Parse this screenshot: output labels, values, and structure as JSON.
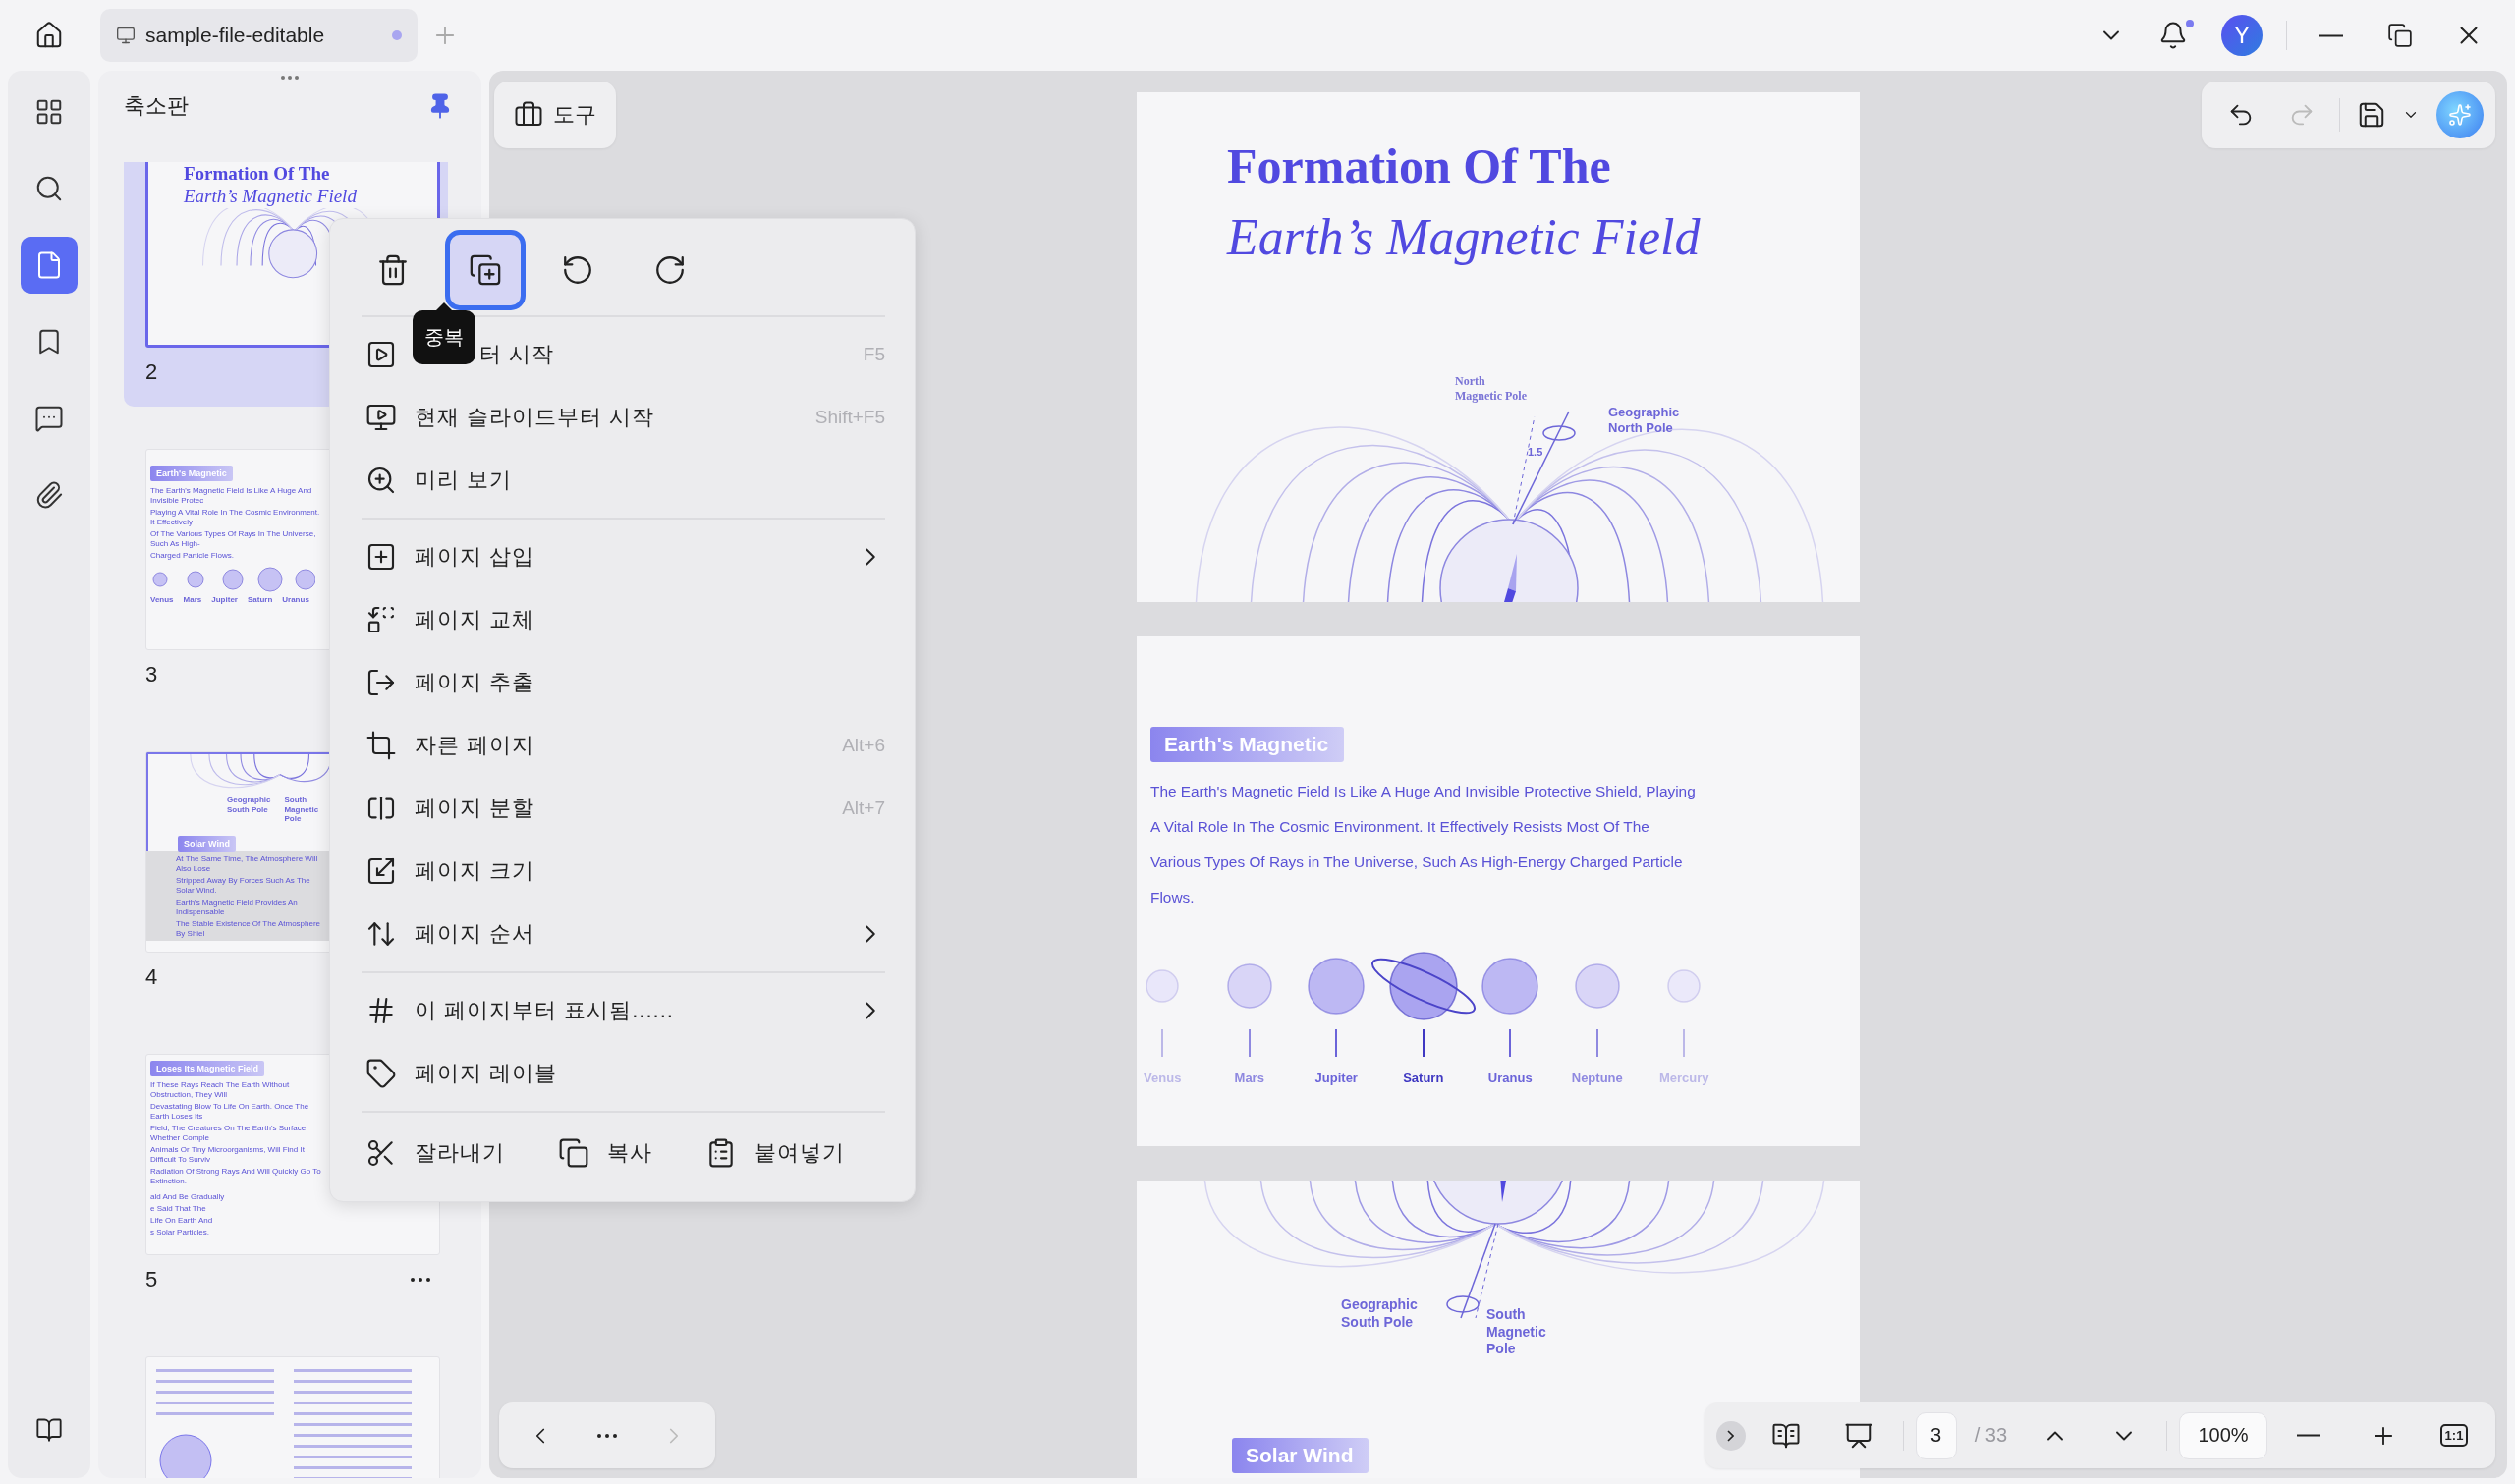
{
  "titlebar": {
    "tab": {
      "title": "sample-file-editable",
      "unsaved": true
    },
    "notification": {
      "unread": true
    },
    "avatar": "Y"
  },
  "sidebar": {
    "items": [
      {
        "selected": false
      },
      {
        "selected": false
      },
      {
        "selected": true
      },
      {
        "selected": false
      },
      {
        "selected": false
      },
      {
        "selected": false
      }
    ]
  },
  "thumbnails": {
    "title": "축소판",
    "pages": [
      {
        "kind": "title",
        "label": "2",
        "selected": true,
        "title": "Formation Of The",
        "subtitle": "Earth’s Magnetic Field"
      },
      {
        "kind": "planets",
        "label": "3",
        "selected": false,
        "heading": "Earth's Magnetic",
        "lines": [
          "The Earth's Magnetic Field Is Like A Huge And Invisible Protec",
          "Playing A Vital Role In The Cosmic Environment. It Effectively",
          "Of The Various Types Of Rays In The Universe, Such As High-",
          "Charged Particle Flows."
        ],
        "planets": [
          "Venus",
          "Mars",
          "Jupiter",
          "Saturn",
          "Uranus"
        ]
      },
      {
        "kind": "field",
        "label": "4",
        "selected": false,
        "labels": [
          "Geographic\nSouth Pole",
          "South\nMagnetic\nPole"
        ],
        "heading": "Solar Wind",
        "lines": [
          "At The Same Time, The Atmosphere Will Also Lose",
          "Stripped Away By Forces Such As The Solar Wind.",
          "Earth's Magnetic Field Provides An Indispensable",
          "The Stable Existence Of The Atmosphere By Shiel"
        ]
      },
      {
        "kind": "text",
        "label": "5",
        "selected": false,
        "more": true,
        "heading": "Loses Its Magnetic Field",
        "lines": [
          "If These Rays Reach The Earth Without Obstruction, They Will",
          "Devastating Blow To Life On Earth. Once The Earth Loses Its",
          "Field, The Creatures On The Earth's Surface, Whether Comple",
          "Animals Or Tiny Microorganisms, Will Find It Difficult To Surviv",
          "Radiation Of Strong Rays And Will Quickly Go To Extinction."
        ],
        "tail": [
          "ald And Be Gradually",
          "e Said That The",
          "Life On Earth And",
          "s Solar Particles."
        ]
      },
      {
        "kind": "columns",
        "selected": false
      }
    ]
  },
  "tools_button": "도구",
  "context_menu": {
    "actions": [
      {
        "selected": false
      },
      {
        "selected": true
      },
      {
        "selected": false
      },
      {
        "selected": false
      }
    ],
    "tooltip": "중복",
    "groups": [
      [
        {
          "label": "터 시작",
          "shortcut": "F5",
          "submenu": false
        },
        {
          "label": "현재 슬라이드부터 시작",
          "shortcut": "Shift+F5",
          "submenu": false
        },
        {
          "label": "미리 보기",
          "submenu": false
        }
      ],
      [
        {
          "label": "페이지 삽입",
          "submenu": true
        },
        {
          "label": "페이지 교체",
          "submenu": false
        },
        {
          "label": "페이지 추출",
          "submenu": false
        },
        {
          "label": "자른 페이지",
          "shortcut": "Alt+6",
          "submenu": false
        },
        {
          "label": "페이지 분할",
          "shortcut": "Alt+7",
          "submenu": false
        },
        {
          "label": "페이지 크기",
          "submenu": false
        },
        {
          "label": "페이지 순서",
          "submenu": true
        }
      ],
      [
        {
          "label": "이 페이지부터 표시됨......",
          "submenu": true
        },
        {
          "label": "페이지 레이블",
          "submenu": false
        }
      ]
    ],
    "clipboard": [
      "잘라내기",
      "복사",
      "붙여넣기"
    ]
  },
  "slides": [
    {
      "kind": "title",
      "title": "Formation Of The",
      "subtitle": "Earth’s Magnetic Field",
      "magnetic_pole": "North\nMagnetic Pole",
      "geographic_pole": "Geographic\nNorth Pole",
      "angle": "1.5"
    },
    {
      "kind": "planets",
      "heading": "Earth's Magnetic",
      "paragraph": "The Earth's Magnetic Field Is Like A Huge And Invisible Protective Shield, Playing A Vital Role In The Cosmic Environment. It Effectively Resists Most Of The Various Types Of Rays in The Universe, Such As High-Energy Charged Particle Flows.",
      "planets": [
        {
          "name": "Venus",
          "kind": "small",
          "color": "#e9e7fa"
        },
        {
          "name": "Mars",
          "kind": "medium",
          "color": "#d9d5f7"
        },
        {
          "name": "Jupiter",
          "kind": "large",
          "color": "#bdb8f3"
        },
        {
          "name": "Saturn",
          "kind": "ringed",
          "color": "#aaa4f0"
        },
        {
          "name": "Uranus",
          "kind": "large",
          "color": "#bdb8f3"
        },
        {
          "name": "Neptune",
          "kind": "medium",
          "color": "#d9d5f7"
        },
        {
          "name": "Mercury",
          "kind": "small",
          "color": "#ebe9fa"
        }
      ]
    },
    {
      "kind": "field",
      "geographic_pole": "Geographic\nSouth Pole",
      "magnetic_pole": "South\nMagnetic\nPole",
      "heading": "Solar Wind"
    }
  ],
  "bottom_bar": {
    "page": "3",
    "total": "/ 33",
    "zoom": "100%",
    "actual_size": "1:1"
  },
  "nav": {
    "next_disabled": true
  }
}
